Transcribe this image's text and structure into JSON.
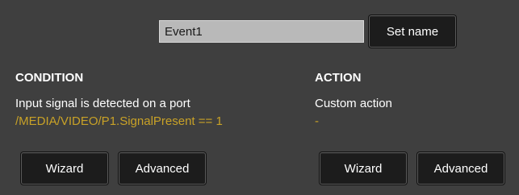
{
  "event": {
    "name_value": "Event1",
    "set_name_label": "Set name"
  },
  "condition": {
    "heading": "CONDITION",
    "description": "Input signal is detected on a port",
    "detail": "/MEDIA/VIDEO/P1.SignalPresent == 1",
    "wizard_label": "Wizard",
    "advanced_label": "Advanced"
  },
  "action": {
    "heading": "ACTION",
    "description": "Custom action",
    "detail": "-",
    "wizard_label": "Wizard",
    "advanced_label": "Advanced"
  },
  "colors": {
    "background": "#3f3f3f",
    "button_bg": "#1c1c1c",
    "accent_detail": "#c9a227",
    "input_bg": "#b9b9b9"
  }
}
